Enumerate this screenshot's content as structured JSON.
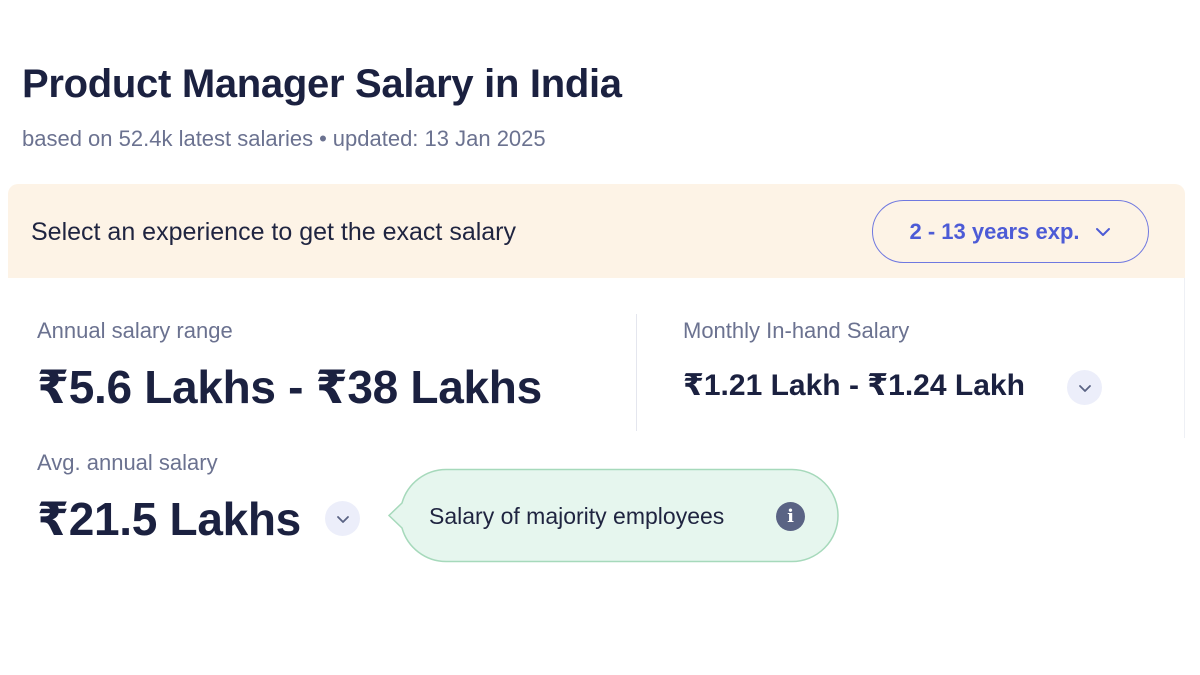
{
  "header": {
    "title": "Product Manager Salary in India",
    "based_on": "based on 52.4k latest salaries",
    "separator": "•",
    "updated": "updated: 13 Jan 2025"
  },
  "experience": {
    "prompt": "Select an experience to get the exact salary",
    "selected": "2 - 13 years exp.",
    "icon": "chevron-down-icon"
  },
  "salary": {
    "range_label": "Annual salary range",
    "range_value": "₹5.6 Lakhs - ₹38 Lakhs",
    "monthly_label": "Monthly In-hand Salary",
    "monthly_value": "₹1.21 Lakh - ₹1.24 Lakh",
    "avg_label": "Avg. annual salary",
    "avg_value": "₹21.5 Lakhs"
  },
  "tooltip": {
    "text": "Salary of majority employees",
    "info_glyph": "i",
    "colors": {
      "fill": "#e6f6ee",
      "border": "#a6d9bb"
    }
  },
  "colors": {
    "accent": "#4d5bd6",
    "banner_bg": "#fdf3e6",
    "heading": "#1b2140",
    "muted": "#6b7290"
  }
}
